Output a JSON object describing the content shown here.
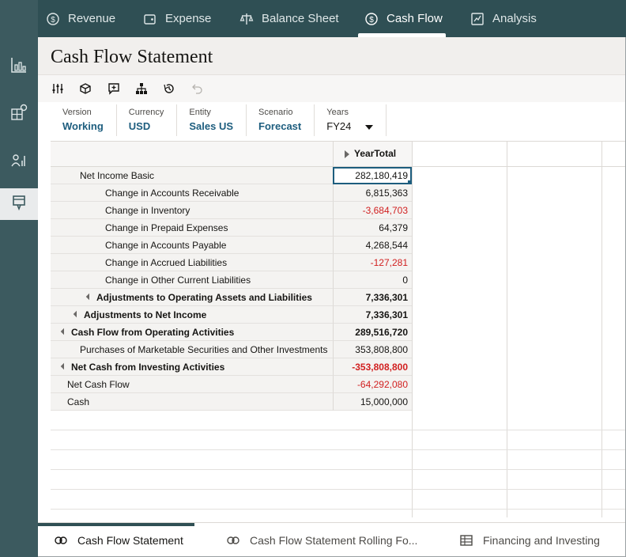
{
  "top_tabs": [
    {
      "label": "Revenue",
      "icon": "dollar-circle-icon",
      "active": false
    },
    {
      "label": "Expense",
      "icon": "wallet-icon",
      "active": false
    },
    {
      "label": "Balance Sheet",
      "icon": "balance-scale-icon",
      "active": false
    },
    {
      "label": "Cash Flow",
      "icon": "cash-flow-icon",
      "active": true
    },
    {
      "label": "Analysis",
      "icon": "analysis-icon",
      "active": false
    }
  ],
  "left_rail": [
    {
      "icon": "bar-chart-icon",
      "active": false
    },
    {
      "icon": "grid-settings-icon",
      "active": false
    },
    {
      "icon": "person-chart-icon",
      "active": false
    },
    {
      "icon": "clipboard-icon",
      "active": true
    }
  ],
  "page_title": "Cash Flow Statement",
  "toolbar_icons": [
    "sliders-icon",
    "cube-icon",
    "comment-add-icon",
    "hierarchy-icon",
    "history-icon",
    "undo-icon"
  ],
  "pov": [
    {
      "label": "Version",
      "value": "Working"
    },
    {
      "label": "Currency",
      "value": "USD"
    },
    {
      "label": "Entity",
      "value": "Sales US"
    },
    {
      "label": "Scenario",
      "value": "Forecast"
    },
    {
      "label": "Years",
      "value": "FY24"
    }
  ],
  "grid": {
    "column_header": "YearTotal",
    "rows": [
      {
        "label": "Net Income Basic",
        "value": "282,180,419"
      },
      {
        "label": "Change in Accounts Receivable",
        "value": "6,815,363"
      },
      {
        "label": "Change in Inventory",
        "value": "-3,684,703"
      },
      {
        "label": "Change in Prepaid Expenses",
        "value": "64,379"
      },
      {
        "label": "Change in Accounts Payable",
        "value": "4,268,544"
      },
      {
        "label": "Change in Accrued Liabilities",
        "value": "-127,281"
      },
      {
        "label": "Change in Other Current Liabilities",
        "value": "0"
      },
      {
        "label": "Adjustments to Operating Assets and Liabilities",
        "value": "7,336,301"
      },
      {
        "label": "Adjustments to Net Income",
        "value": "7,336,301"
      },
      {
        "label": "Cash Flow from Operating Activities",
        "value": "289,516,720"
      },
      {
        "label": "Purchases of Marketable Securities and Other Investments",
        "value": "353,808,800"
      },
      {
        "label": "Net Cash from Investing Activities",
        "value": "-353,808,800"
      },
      {
        "label": "Net Cash Flow",
        "value": "-64,292,080"
      },
      {
        "label": "Cash",
        "value": "15,000,000"
      }
    ]
  },
  "bottom_tabs": [
    {
      "label": "Cash Flow Statement",
      "icon": "form-icon",
      "active": true
    },
    {
      "label": "Cash Flow Statement Rolling Fo...",
      "icon": "form-icon",
      "active": false
    },
    {
      "label": "Financing and Investing",
      "icon": "spreadsheet-icon",
      "active": false
    }
  ],
  "colors": {
    "header_bg": "#2f4f54",
    "rail_bg": "#3c5a5f",
    "accent": "#1d5d7e",
    "negative": "#d11f1f"
  }
}
